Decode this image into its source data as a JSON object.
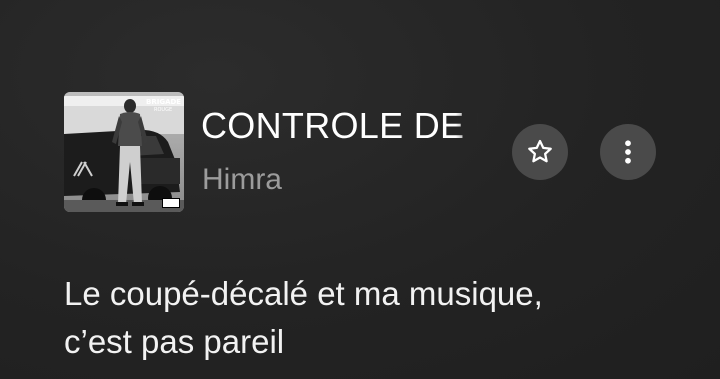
{
  "now_playing": {
    "title": "CONTROLE DE POLICE",
    "artist": "Himra",
    "cover_art_text": "BRIGADE ROUGE",
    "parental_label": "EXPLICIT"
  },
  "actions": {
    "favorite_icon": "star-icon",
    "more_icon": "more-vertical-icon"
  },
  "lyrics": {
    "lines": [
      "Le coupé-décalé et ma musique,",
      "c’est pas pareil"
    ]
  },
  "colors": {
    "background": "#232323",
    "artist_text": "#9c9c9c",
    "button_bg": "#4a4a4a"
  }
}
